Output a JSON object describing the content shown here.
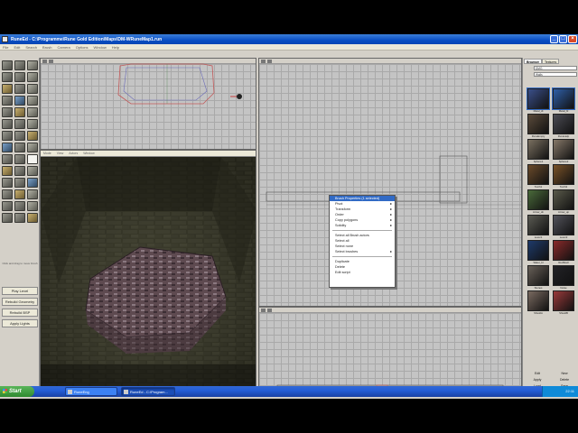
{
  "window": {
    "title": "RuneEd - C:\\Programme\\Rune Gold Edition\\Maps\\DM-WRuneMap1.run"
  },
  "menubar": [
    "File",
    "Edit",
    "Search",
    "Brush",
    "Camera",
    "Options",
    "Window",
    "Help"
  ],
  "toolbox": {
    "tool_count": 42,
    "status_note": "Click and drag to move brush",
    "buttons": [
      "Play Level",
      "Rebuild Geometry",
      "Rebuild BSP",
      "Apply Lights"
    ]
  },
  "viewport_3d": {
    "menu": [
      "Mode",
      "View",
      "Actors",
      "Window"
    ]
  },
  "context_menu": {
    "items": [
      {
        "label": "Brush Properties (1 selected)",
        "highlight": true
      },
      {
        "label": "Pivot",
        "submenu": true
      },
      {
        "label": "Transform",
        "submenu": true
      },
      {
        "label": "Order",
        "submenu": true
      },
      {
        "label": "Copy polygons",
        "submenu": true
      },
      {
        "label": "Solidity",
        "submenu": true
      },
      {
        "separator": true
      },
      {
        "label": "Select all Brush actors"
      },
      {
        "label": "Select all"
      },
      {
        "label": "Select none"
      },
      {
        "label": "Select brushes",
        "submenu": true
      },
      {
        "separator": true
      },
      {
        "label": "Duplicate"
      },
      {
        "label": "Delete"
      },
      {
        "label": "Edit script"
      }
    ]
  },
  "browser": {
    "tabs": [
      "Browser",
      "Textures"
    ],
    "package": "DMG",
    "group": "Walls",
    "textures": [
      {
        "name": "Metal_dt",
        "color": "#3a4f8a"
      },
      {
        "name": "Metal_bl",
        "color": "#2f5fa8"
      },
      {
        "name": "RuneEmpty",
        "color": "#5a4a3a"
      },
      {
        "name": "RuneHelp",
        "color": "#4a4a52"
      },
      {
        "name": "Sphere1",
        "color": "#7a7060"
      },
      {
        "name": "Sphere2",
        "color": "#867868"
      },
      {
        "name": "Torch1",
        "color": "#6a4a2a"
      },
      {
        "name": "Torch2",
        "color": "#7a5228"
      },
      {
        "name": "Arrow_dn",
        "color": "#4a6a3a"
      },
      {
        "name": "Arrow_up",
        "color": "#5a5a4a"
      },
      {
        "name": "Lever1",
        "color": "#5a5a52"
      },
      {
        "name": "Lever2",
        "color": "#52525a"
      },
      {
        "name": "Water_bl",
        "color": "#1e3a6a"
      },
      {
        "name": "RedSkull",
        "color": "#8a2a2a"
      },
      {
        "name": "Stones",
        "color": "#686058"
      },
      {
        "name": "Noise",
        "color": "#222226"
      },
      {
        "name": "ShieldA",
        "color": "#7a6a60"
      },
      {
        "name": "ShieldB",
        "color": "#9a3a3a"
      }
    ],
    "bottom_buttons": [
      "Edit",
      "New",
      "Apply",
      "Delete",
      "Load",
      "Save",
      "Import",
      "Export"
    ]
  },
  "taskbar": {
    "start_label": "Start",
    "tasks": [
      {
        "label": "RuneEng",
        "active": false
      },
      {
        "label": "RuneEd - C:\\Program...",
        "active": true
      }
    ],
    "clock": "22:11"
  },
  "colors": {
    "titlebar": "#0a4fc4",
    "highlight": "#316ac5",
    "viewport_bg": "#c4c4c4"
  }
}
